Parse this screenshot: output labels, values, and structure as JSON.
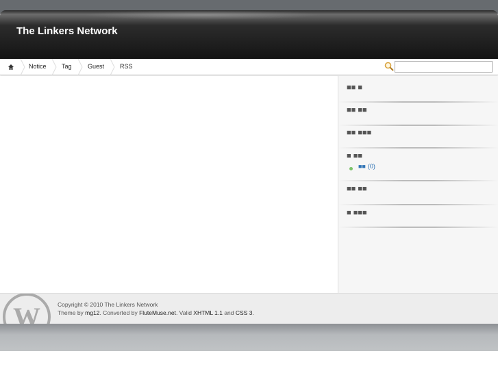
{
  "header": {
    "title": "The Linkers Network"
  },
  "nav": {
    "items": [
      {
        "label": "Notice"
      },
      {
        "label": "Tag"
      },
      {
        "label": "Guest"
      },
      {
        "label": "RSS"
      }
    ],
    "search_value": ""
  },
  "sidebar": {
    "widgets": [
      {
        "title": "■■ ■"
      },
      {
        "title": "■■ ■■"
      },
      {
        "title": "■■ ■■■"
      },
      {
        "title": "■ ■■"
      },
      {
        "title": "■■ ■■"
      },
      {
        "title": "■ ■■■"
      }
    ],
    "category": {
      "label": "■■",
      "count": "(0)"
    }
  },
  "footer": {
    "line1": "Copyright © 2010 The Linkers Network",
    "theme_by": "Theme by ",
    "mg12": "mg12",
    "converted": ". Converted by ",
    "flutemuse": "FluteMuse.net",
    "valid": ". Valid ",
    "xhtml": "XHTML 1.1",
    "and": " and ",
    "css": "CSS 3",
    "end": "."
  }
}
